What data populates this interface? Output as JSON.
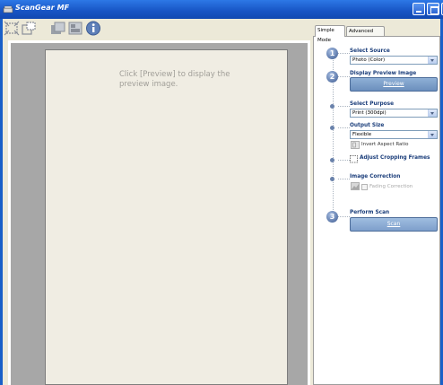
{
  "window": {
    "title": "ScanGear MF",
    "title_color": "#1754c4"
  },
  "toolbar": {
    "icons": [
      "auto-crop-icon",
      "crop-icon",
      "zoom-icon",
      "multi-crop-icon",
      "info-icon"
    ]
  },
  "preview": {
    "hint": "Click [Preview] to display the preview image."
  },
  "tabs": [
    {
      "label": "Simple Mode",
      "active": true
    },
    {
      "label": "Advanced Mode",
      "active": false
    }
  ],
  "steps": {
    "select_source": {
      "number": "1",
      "label": "Select Source",
      "value": "Photo (Color)"
    },
    "display_preview": {
      "number": "2",
      "label": "Display Preview Image",
      "button": "Preview"
    },
    "select_purpose": {
      "label": "Select Purpose",
      "value": "Print (300dpi)"
    },
    "output_size": {
      "label": "Output Size",
      "value": "Flexible",
      "invert_label": "Invert Aspect Ratio"
    },
    "adjust_cropping": {
      "label": "Adjust Cropping Frames"
    },
    "image_correction": {
      "label": "Image Correction",
      "fading_label": "Fading Correction"
    },
    "perform_scan": {
      "number": "3",
      "label": "Perform Scan",
      "button": "Scan"
    }
  }
}
